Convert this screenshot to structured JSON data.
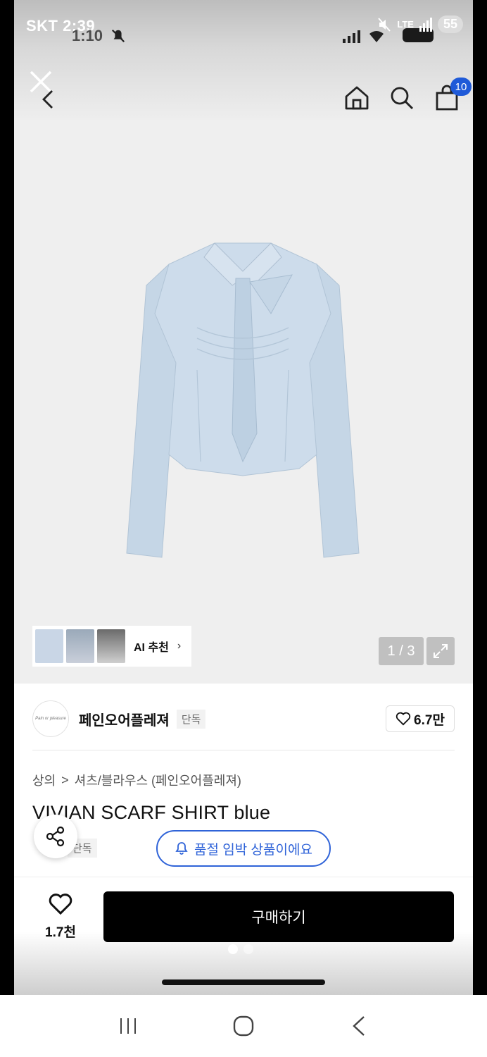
{
  "status": {
    "carrier": "SKT",
    "time": "2:39",
    "inner_time": "1:10",
    "network": "LTE",
    "battery": "55"
  },
  "header": {
    "cart_count": "10"
  },
  "gallery": {
    "ai_label": "AI 추천",
    "page_counter": "1 / 3"
  },
  "brand": {
    "logo_text": "Pain or pleasure",
    "name": "페인오어플레져",
    "exclusive_badge": "단독",
    "likes": "6.7만"
  },
  "breadcrumb": {
    "category": "상의",
    "subcategory": "셔츠/블라우스 (페인오어플레져)"
  },
  "product": {
    "title": "VIVIAN SCARF SHIRT blue",
    "exclusive_badge": "단독",
    "soldout_notice": "품절 임박 상품이에요"
  },
  "action_bar": {
    "wish_count": "1.7천",
    "buy_label": "구매하기"
  },
  "colors": {
    "accent_blue": "#2f63d8",
    "shirt_blue": "#c5d6e6",
    "buy_button": "#000000"
  }
}
